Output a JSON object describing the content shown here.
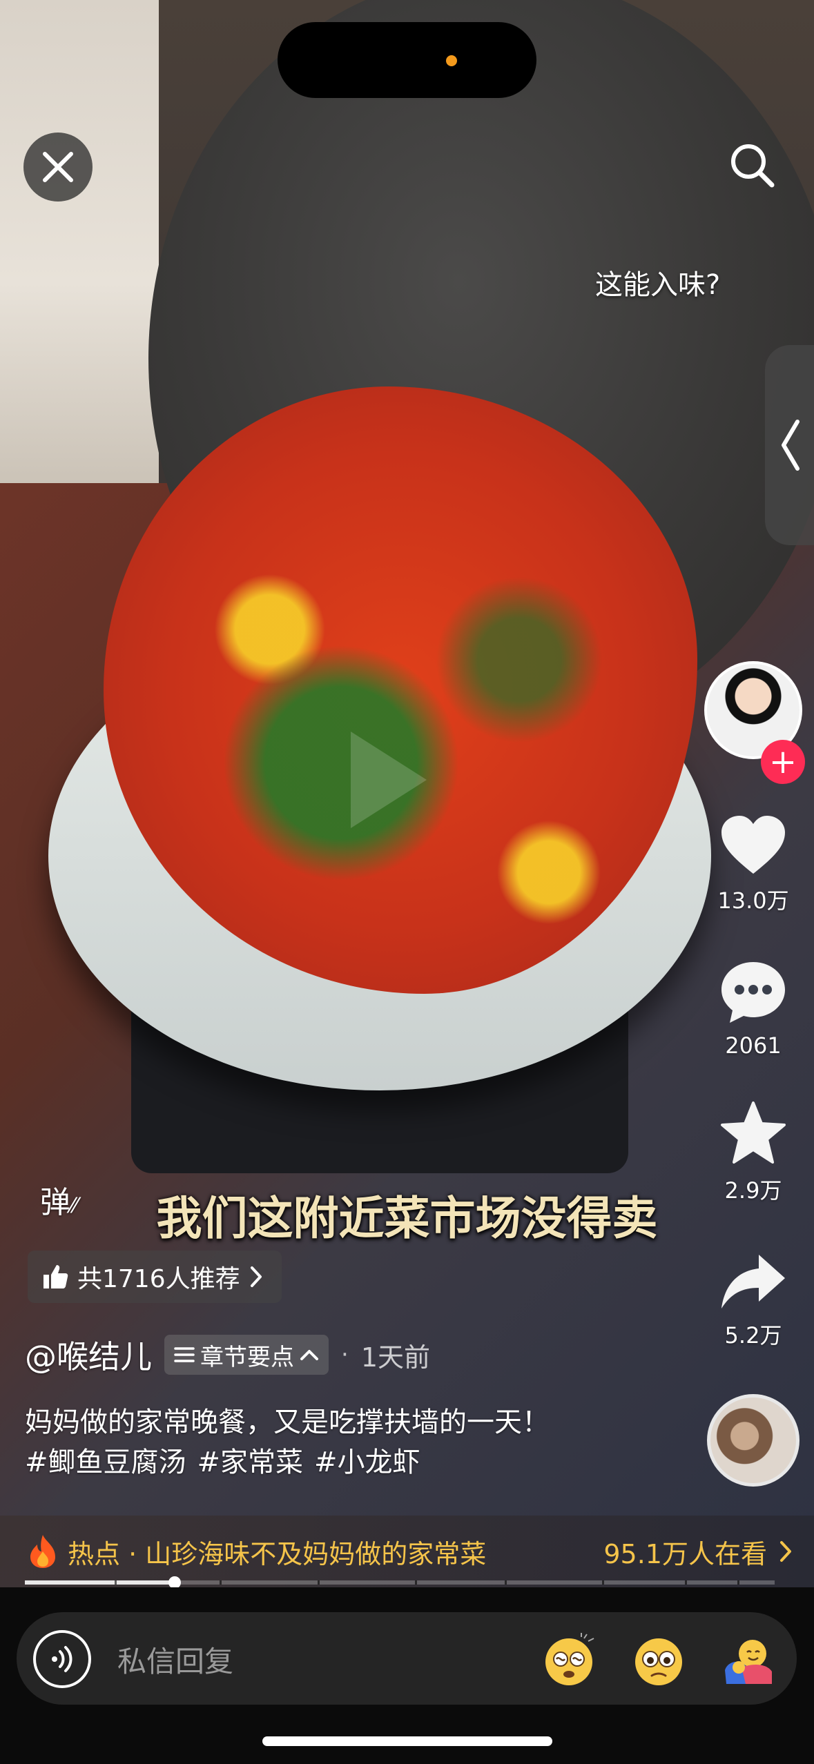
{
  "video": {
    "top_caption": "这能入味?",
    "subtitle": "我们这附近菜市场没得卖",
    "danmu_label": "弹"
  },
  "top_bar": {
    "close_icon": "close-icon",
    "search_icon": "search-icon"
  },
  "side": {
    "collapse_icon": "chevron-left-icon"
  },
  "actions": {
    "like_count": "13.0万",
    "comment_count": "2061",
    "favorite_count": "2.9万",
    "share_count": "5.2万"
  },
  "recommend": {
    "text": "共1716人推荐"
  },
  "post": {
    "author": "@喉结儿",
    "chapters_label": "章节要点",
    "separator": "·",
    "time_ago": "1天前",
    "description": "妈妈做的家常晚餐，又是吃撑扶墙的一天！",
    "tags": [
      "#鲫鱼豆腐汤",
      "#家常菜",
      "#小龙虾"
    ]
  },
  "hot": {
    "label": "热点 · 山珍海味不及妈妈做的家常菜",
    "viewers": "95.1万人在看"
  },
  "progress": {
    "fraction": 0.2,
    "chapter_marks": [
      0.12,
      0.26,
      0.39,
      0.52,
      0.64,
      0.77,
      0.88,
      0.95
    ]
  },
  "reply": {
    "placeholder": "私信回复"
  },
  "colors": {
    "accent_red": "#fe2c55",
    "hot_yellow": "#f5c44a",
    "subtitle_cream": "#f3e4b8"
  }
}
